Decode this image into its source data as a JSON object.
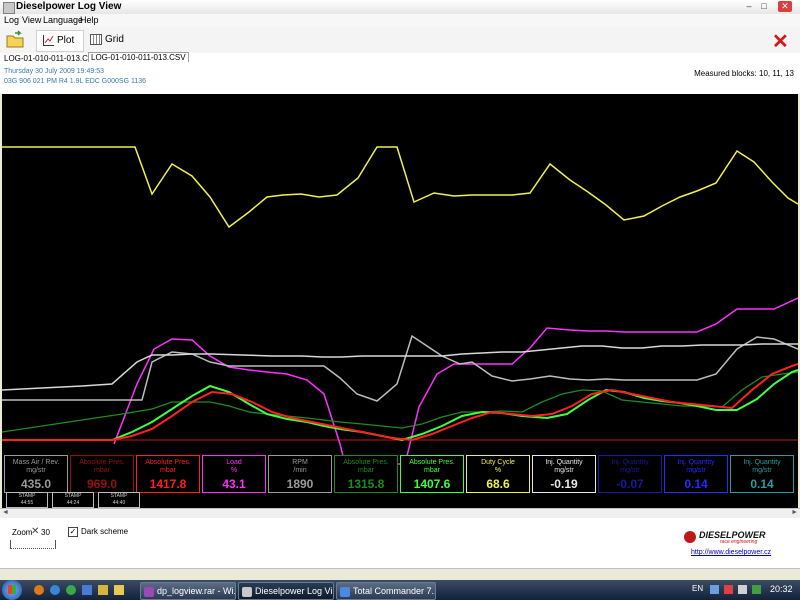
{
  "window": {
    "title": "Dieselpower Log View",
    "min": "–",
    "max": "□",
    "close": "✕"
  },
  "menu": [
    "Log",
    "View",
    "Language",
    "Help"
  ],
  "toolbar": {
    "plot_label": "Plot",
    "grid_label": "Grid",
    "close_symbol": "✕"
  },
  "doc_tabs": [
    "LOG-01-010-011-013.CSV",
    "LOG-01-010-011-013.CSV"
  ],
  "info": {
    "datetime": "Thursday 30 July 2009 19:49:53",
    "ecu": "03G 906 021 PM  R4 1.9L EDC G000SG  1136",
    "measured_blocks": "Measured blocks: 10, 11, 13"
  },
  "colors": {
    "yellow": "#f0f050",
    "magenta": "#ff30ff",
    "grey": "#bdbdbd",
    "white_line": "#d0d0d0",
    "green": "#40ff40",
    "dark_green": "#1f8c1f",
    "red": "#ff2020",
    "dark_red": "#9a1010",
    "blue": "#2828ff",
    "teal": "#2c9aa0"
  },
  "channels": [
    {
      "l1": "Mass Air / Rev.",
      "l2": "mg/str",
      "value": "435.0",
      "color": "#9a9a9a"
    },
    {
      "l1": "Absolute Pres.",
      "l2": "mbar",
      "value": "969.0",
      "color": "#9a1010"
    },
    {
      "l1": "Absolute Pres.",
      "l2": "mbar",
      "value": "1417.8",
      "color": "#ff2020"
    },
    {
      "l1": "Load",
      "l2": "%",
      "value": "43.1",
      "color": "#ff30ff"
    },
    {
      "l1": "RPM",
      "l2": "/min",
      "value": "1890",
      "color": "#9a9a9a"
    },
    {
      "l1": "Absolute Pres.",
      "l2": "mbar",
      "value": "1315.8",
      "color": "#1f8c1f"
    },
    {
      "l1": "Absolute Pres.",
      "l2": "mbar",
      "value": "1407.6",
      "color": "#40ff40"
    },
    {
      "l1": "Duty Cycle",
      "l2": "%",
      "value": "68.6",
      "color": "#f0f050"
    },
    {
      "l1": "Inj. Quantity",
      "l2": "mg/str",
      "value": "-0.19",
      "color": "#e8e8e8"
    },
    {
      "l1": "Inj. Quantity",
      "l2": "mg/str",
      "value": "-0.07",
      "color": "#1818a0"
    },
    {
      "l1": "Inj. Quantity",
      "l2": "mg/str",
      "value": "0.14",
      "color": "#2828ff"
    },
    {
      "l1": "Inj. Quantity",
      "l2": "mg/str",
      "value": "0.14",
      "color": "#2c9aa0"
    }
  ],
  "stamps": [
    {
      "label": "STAMP",
      "value": "44:55"
    },
    {
      "label": "STAMP",
      "value": "44:24"
    },
    {
      "label": "STAMP",
      "value": "44:40"
    }
  ],
  "bottom": {
    "zoom_label": "Zoom",
    "zoom_value": "30",
    "dark_scheme_label": "Dark scheme",
    "dark_scheme_checked": true,
    "logo_main": "DIESELPOWER",
    "logo_sub": "race engineering",
    "website": "http://www.dieselpower.cz"
  },
  "taskbar": {
    "items": [
      "dp_logview.rar - Wi...",
      "Dieselpower Log Vi...",
      "Total Commander 7...."
    ],
    "lang": "EN",
    "clock": "20:32"
  }
}
